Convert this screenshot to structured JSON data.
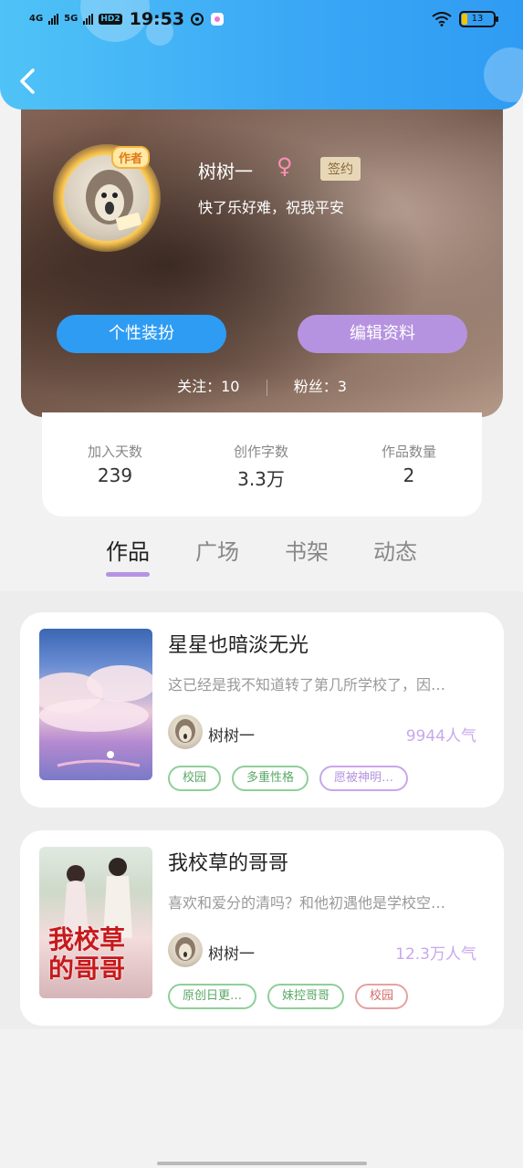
{
  "status_bar": {
    "net1": "4G",
    "net2": "5G",
    "hd": "HD2",
    "time": "19:53",
    "battery": "13"
  },
  "profile": {
    "author_badge": "作者",
    "name": "树树一",
    "gender_symbol": "♀",
    "sign_badge": "签约",
    "bio": "快了乐好难，祝我平安",
    "dress_button": "个性装扮",
    "edit_button": "编辑资料",
    "follow_label": "关注：10",
    "fans_label": "粉丝：3"
  },
  "stats": [
    {
      "label": "加入天数",
      "value": "239"
    },
    {
      "label": "创作字数",
      "value": "3.3万"
    },
    {
      "label": "作品数量",
      "value": "2"
    }
  ],
  "tabs": [
    "作品",
    "广场",
    "书架",
    "动态"
  ],
  "works": [
    {
      "title": "星星也暗淡无光",
      "desc": "这已经是我不知道转了第几所学校了，因…",
      "author": "树树一",
      "popularity": "9944人气",
      "tags": [
        {
          "label": "校园",
          "color": "green"
        },
        {
          "label": "多重性格",
          "color": "green"
        },
        {
          "label": "愿被神明…",
          "color": "purple"
        }
      ]
    },
    {
      "title": "我校草的哥哥",
      "desc": "喜欢和爱分的清吗？和他初遇他是学校空…",
      "author": "树树一",
      "popularity": "12.3万人气",
      "cover_text": "我校草的哥哥",
      "tags": [
        {
          "label": "原创日更…",
          "color": "green"
        },
        {
          "label": "妹控哥哥",
          "color": "green"
        },
        {
          "label": "校园",
          "color": "red"
        }
      ]
    }
  ]
}
